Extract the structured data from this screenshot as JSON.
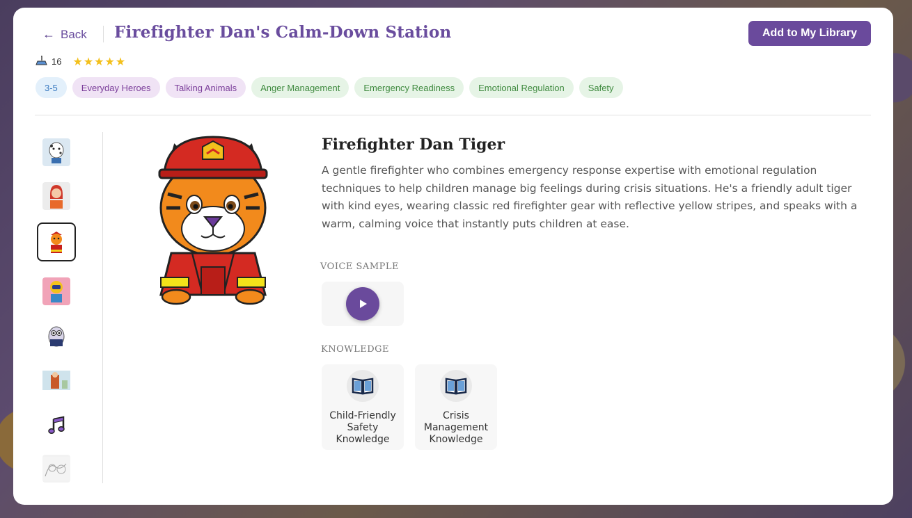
{
  "header": {
    "back_label": "Back",
    "title": "Firefighter Dan's Calm-Down Station",
    "add_button_label": "Add to My Library"
  },
  "stats": {
    "uses_count": "16",
    "stars": "★★★★★",
    "rating": 5
  },
  "tags": [
    {
      "label": "3-5",
      "kind": "age"
    },
    {
      "label": "Everyday Heroes",
      "kind": "theme"
    },
    {
      "label": "Talking Animals",
      "kind": "theme"
    },
    {
      "label": "Anger Management",
      "kind": "skill"
    },
    {
      "label": "Emergency Readiness",
      "kind": "skill"
    },
    {
      "label": "Emotional Regulation",
      "kind": "skill"
    },
    {
      "label": "Safety",
      "kind": "skill"
    }
  ],
  "thumbnails": [
    {
      "name": "dalmatian-thumbnail",
      "icon": "dalmatian",
      "active": false
    },
    {
      "name": "firefighter-girl-thumbnail",
      "icon": "red-hair-girl",
      "active": false
    },
    {
      "name": "tiger-thumbnail",
      "icon": "tiger",
      "active": true
    },
    {
      "name": "robot-thumbnail",
      "icon": "robot",
      "active": false
    },
    {
      "name": "owl-thumbnail",
      "icon": "owl",
      "active": false
    },
    {
      "name": "scene-thumbnail",
      "icon": "scene",
      "active": false
    },
    {
      "name": "music-thumbnail",
      "icon": "music-note",
      "active": false
    },
    {
      "name": "sketch-thumbnail",
      "icon": "sketch",
      "active": false
    }
  ],
  "character": {
    "name": "Firefighter Dan Tiger",
    "description": "A gentle firefighter who combines emergency response expertise with emotional regulation techniques to help children manage big feelings during crisis situations. He's a friendly adult tiger with kind eyes, wearing classic red firefighter gear with reflective yellow stripes, and speaks with a warm, calming voice that instantly puts children at ease."
  },
  "voice": {
    "section_label": "VOICE SAMPLE"
  },
  "knowledge": {
    "section_label": "KNOWLEDGE",
    "items": [
      {
        "label": "Child-Friendly Safety Knowledge",
        "icon": "book-icon"
      },
      {
        "label": "Crisis Management Knowledge",
        "icon": "book-icon"
      }
    ]
  },
  "colors": {
    "brand_purple": "#6a4a9c",
    "star_yellow": "#f3c01c"
  }
}
